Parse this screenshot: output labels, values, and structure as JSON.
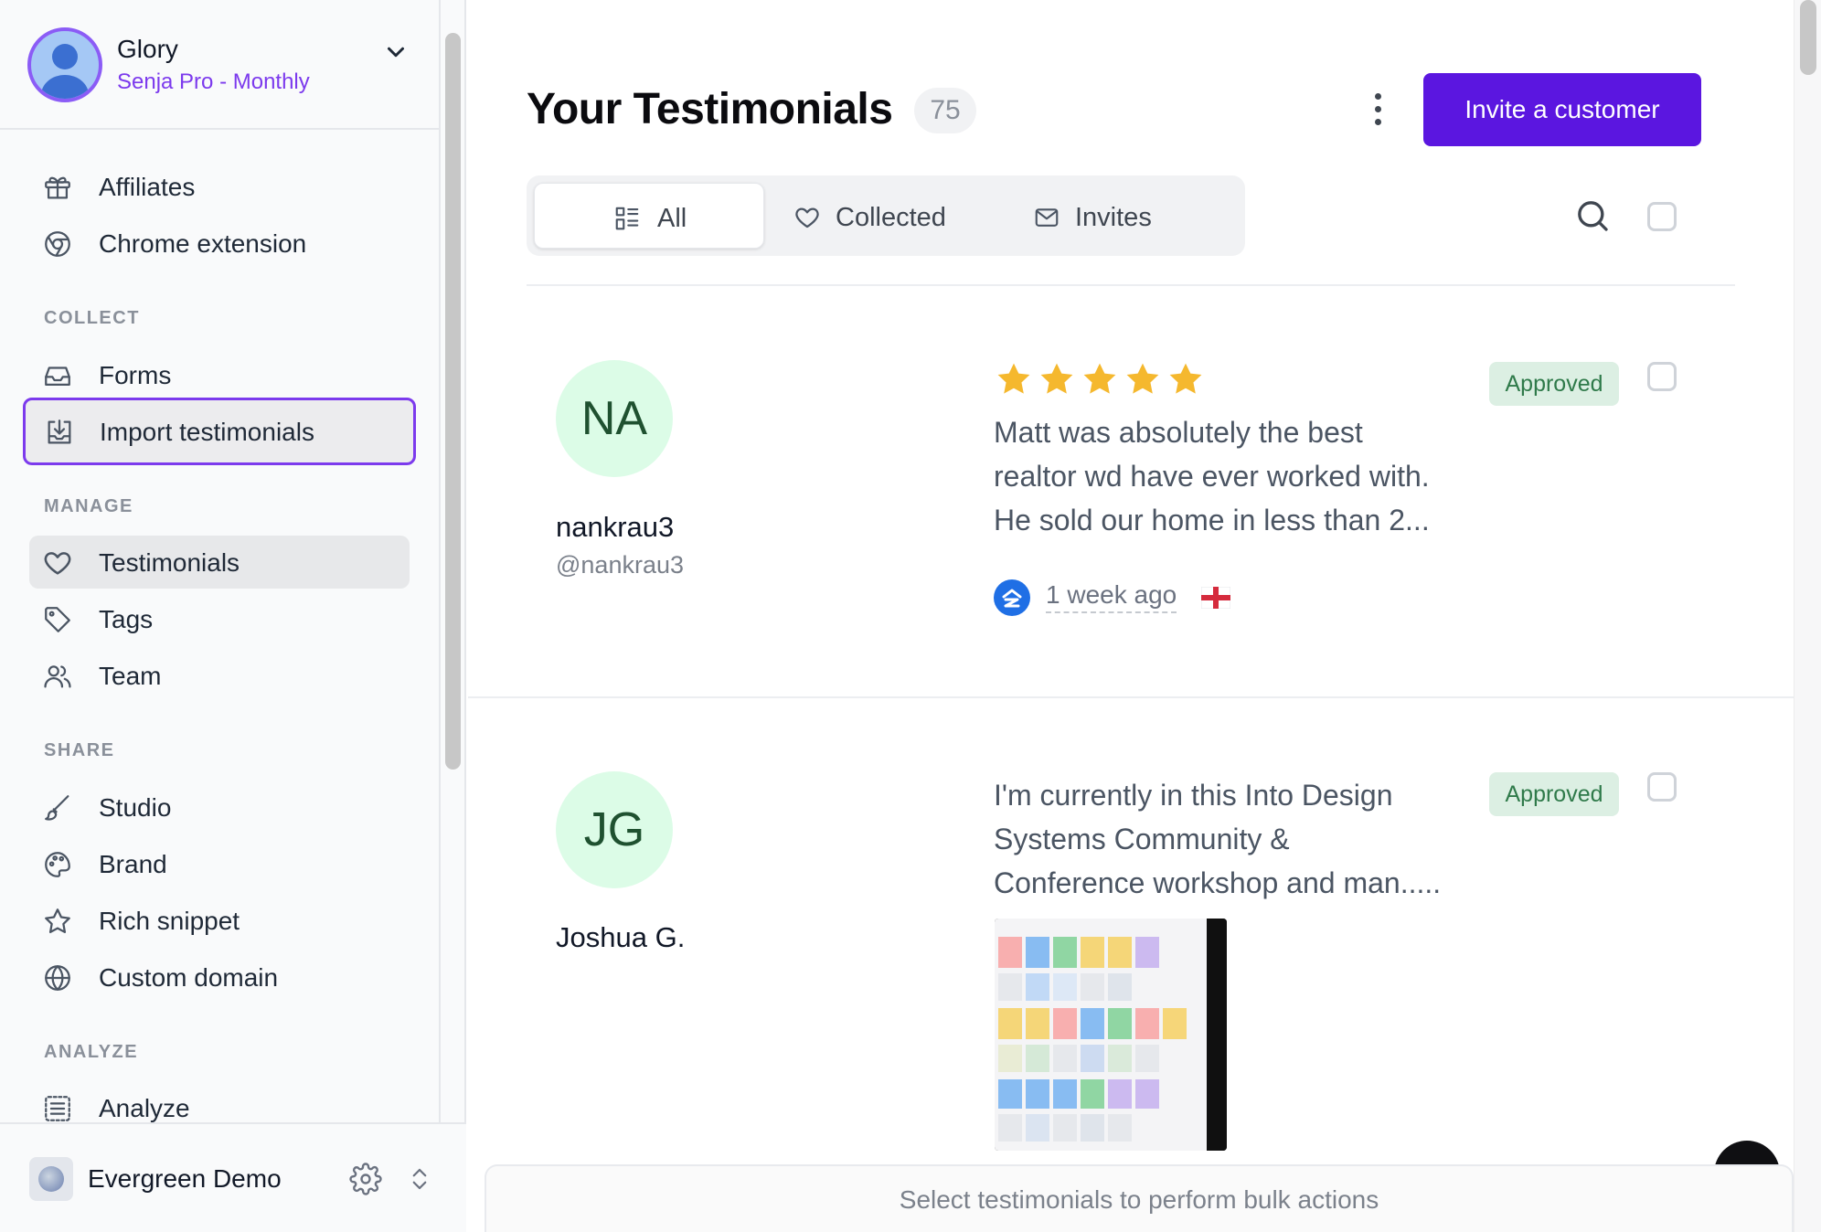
{
  "account": {
    "name": "Glory",
    "plan": "Senja Pro - Monthly"
  },
  "sidebar": {
    "top_items": [
      {
        "label": "Affiliates",
        "icon": "gift-icon"
      },
      {
        "label": "Chrome extension",
        "icon": "chrome-icon"
      }
    ],
    "sections": [
      {
        "label": "COLLECT",
        "items": [
          {
            "label": "Forms",
            "icon": "inbox-icon"
          },
          {
            "label": "Import testimonials",
            "icon": "import-icon",
            "state": "focused"
          }
        ]
      },
      {
        "label": "MANAGE",
        "items": [
          {
            "label": "Testimonials",
            "icon": "heart-icon",
            "state": "active"
          },
          {
            "label": "Tags",
            "icon": "tag-icon"
          },
          {
            "label": "Team",
            "icon": "team-icon"
          }
        ]
      },
      {
        "label": "SHARE",
        "items": [
          {
            "label": "Studio",
            "icon": "brush-icon"
          },
          {
            "label": "Brand",
            "icon": "palette-icon"
          },
          {
            "label": "Rich snippet",
            "icon": "star-icon"
          },
          {
            "label": "Custom domain",
            "icon": "globe-icon"
          }
        ]
      },
      {
        "label": "ANALYZE",
        "items": [
          {
            "label": "Analyze",
            "icon": "list-icon"
          }
        ]
      }
    ],
    "workspace": {
      "name": "Evergreen Demo"
    }
  },
  "main": {
    "title": "Your Testimonials",
    "count": "75",
    "invite_label": "Invite a customer",
    "tabs": [
      {
        "label": "All",
        "icon": "grid-list-icon",
        "active": true
      },
      {
        "label": "Collected",
        "icon": "heart-icon",
        "active": false
      },
      {
        "label": "Invites",
        "icon": "mail-icon",
        "active": false
      }
    ],
    "testimonials": [
      {
        "initials": "NA",
        "name": "nankrau3",
        "handle": "@nankrau3",
        "rating": 5,
        "quote_lines": [
          "Matt was absolutely the best",
          "realtor wd have ever worked with.",
          "He sold our home in less than 2..."
        ],
        "status": "Approved",
        "time": "1 week ago",
        "source_icon": "zillow-icon",
        "flag_icon": "england-flag-icon"
      },
      {
        "initials": "JG",
        "name": "Joshua G.",
        "quote_lines": [
          "I'm currently in this Into Design",
          "Systems Community &",
          "Conference workshop and man....."
        ],
        "status": "Approved",
        "attachment_icon": "screenshot-thumbnail"
      }
    ],
    "bulk_bar_text": "Select testimonials to perform bulk actions"
  },
  "colors": {
    "accent": "#5b16e0",
    "plan_text": "#7c3aed",
    "approved_bg": "#dcefe3",
    "approved_text": "#2f7a4a",
    "avatar_bg": "#dcfce7",
    "star": "#f5b82e"
  }
}
